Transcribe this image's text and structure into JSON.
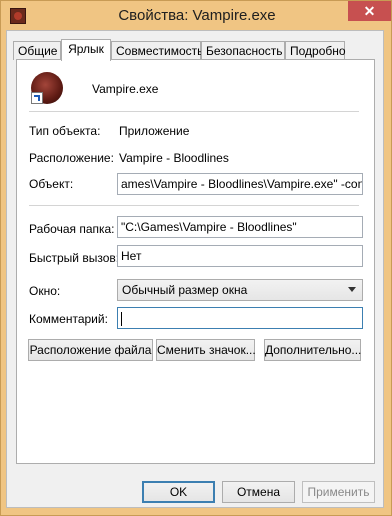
{
  "window": {
    "title": "Свойства: Vampire.exe",
    "close_symbol": "✕"
  },
  "tabs": [
    {
      "label": "Общие",
      "active": false
    },
    {
      "label": "Ярлык",
      "active": true
    },
    {
      "label": "Совместимость",
      "active": false
    },
    {
      "label": "Безопасность",
      "active": false
    },
    {
      "label": "Подробно",
      "active": false
    }
  ],
  "shortcut": {
    "name": "Vampire.exe",
    "type_label": "Тип объекта:",
    "type_value": "Приложение",
    "location_label": "Расположение:",
    "location_value": "Vampire - Bloodlines",
    "target_label": "Объект:",
    "target_value": "ames\\Vampire - Bloodlines\\Vampire.exe\" -console",
    "workdir_label": "Рабочая папка:",
    "workdir_value": "\"C:\\Games\\Vampire - Bloodlines\"",
    "hotkey_label": "Быстрый вызов:",
    "hotkey_value": "Нет",
    "window_label": "Окно:",
    "window_value": "Обычный размер окна",
    "comment_label": "Комментарий:",
    "comment_value": ""
  },
  "panel_buttons": {
    "open_location": "Расположение файла",
    "change_icon": "Сменить значок...",
    "advanced": "Дополнительно..."
  },
  "dialog_buttons": {
    "ok": "OK",
    "cancel": "Отмена",
    "apply": "Применить"
  },
  "icons": {
    "app": "vampire-app-icon",
    "shortcut_arrow": "shortcut-arrow-icon"
  }
}
